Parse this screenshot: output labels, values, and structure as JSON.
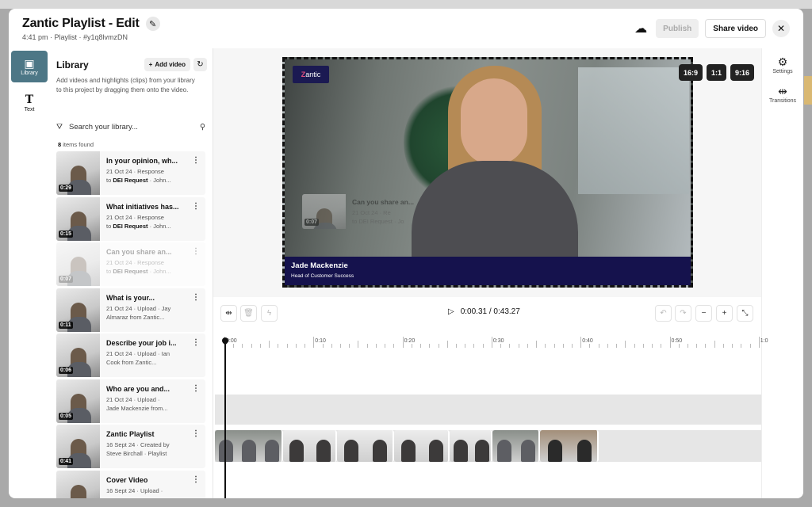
{
  "header": {
    "title": "Zantic Playlist - Edit",
    "meta": "4:41 pm · Playlist · #y1q8lvmzDN",
    "publish_label": "Publish",
    "share_label": "Share video"
  },
  "left_rail": [
    {
      "label": "Library",
      "icon": "library-icon",
      "active": true
    },
    {
      "label": "Text",
      "icon": "text-icon",
      "active": false
    }
  ],
  "library": {
    "title": "Library",
    "add_label": "Add video",
    "description": "Add videos and highlights (clips) from your library to this project by dragging them onto the video.",
    "search_placeholder": "Search your library...",
    "count": "8",
    "count_suffix": " items found",
    "items": [
      {
        "title": "In your opinion, wh...",
        "line1": "21 Oct 24 · Response",
        "line2_pre": "to ",
        "line2_bold": "DEI Request",
        "line2_post": " · John...",
        "duration": "0:29",
        "faded": false
      },
      {
        "title": "What initiatives has...",
        "line1": "21 Oct 24 · Response",
        "line2_pre": "to ",
        "line2_bold": "DEI Request",
        "line2_post": " · John...",
        "duration": "0:15",
        "faded": false
      },
      {
        "title": "Can you share an...",
        "line1": "21 Oct 24 · Response",
        "line2_pre": "to ",
        "line2_bold": "DEI Request",
        "line2_post": " · John...",
        "duration": "0:07",
        "faded": true
      },
      {
        "title": "What is your...",
        "line1": "21 Oct 24 · Upload · Jay",
        "line2_pre": "Almaraz from Zantic...",
        "line2_bold": "",
        "line2_post": "",
        "duration": "0:11",
        "faded": false
      },
      {
        "title": "Describe your job i...",
        "line1": "21 Oct 24 · Upload · Ian",
        "line2_pre": "Cook from Zantic...",
        "line2_bold": "",
        "line2_post": "",
        "duration": "0:06",
        "faded": false
      },
      {
        "title": "Who are you and...",
        "line1": "21 Oct 24 · Upload ·",
        "line2_pre": "Jade Mackenzie from...",
        "line2_bold": "",
        "line2_post": "",
        "duration": "0:05",
        "faded": false
      },
      {
        "title": "Zantic Playlist",
        "line1": "16 Sept 24 · Created by",
        "line2_pre": "Steve Birchall · Playlist",
        "line2_bold": "",
        "line2_post": "",
        "duration": "0:41",
        "faded": false
      },
      {
        "title": "Cover Video",
        "line1": "16 Sept 24 · Upload ·",
        "line2_pre": "",
        "line2_bold": "",
        "line2_post": "",
        "duration": "",
        "faded": false
      }
    ]
  },
  "preview": {
    "logo_text": "antic",
    "ratios": [
      "16:9",
      "1:1",
      "9:16"
    ],
    "lower_third_name": "Jade Mackenzie",
    "lower_third_role": "Head of Customer Success",
    "drag_clip": {
      "title": "Can you share an...",
      "line1": "21 Oct 24 · Re",
      "line2": "to DEI Request · Jo",
      "duration": "0:07"
    }
  },
  "right_rail": [
    {
      "label": "Settings",
      "icon": "gear-icon"
    },
    {
      "label": "Transitions",
      "icon": "transitions-icon"
    }
  ],
  "timeline": {
    "current_time": "0:00.31",
    "separator": " / ",
    "total_time": "0:43.27",
    "ruler_labels": [
      "0:00",
      "0:10",
      "0:20",
      "0:30",
      "0:40",
      "0:50",
      "1:0"
    ]
  }
}
